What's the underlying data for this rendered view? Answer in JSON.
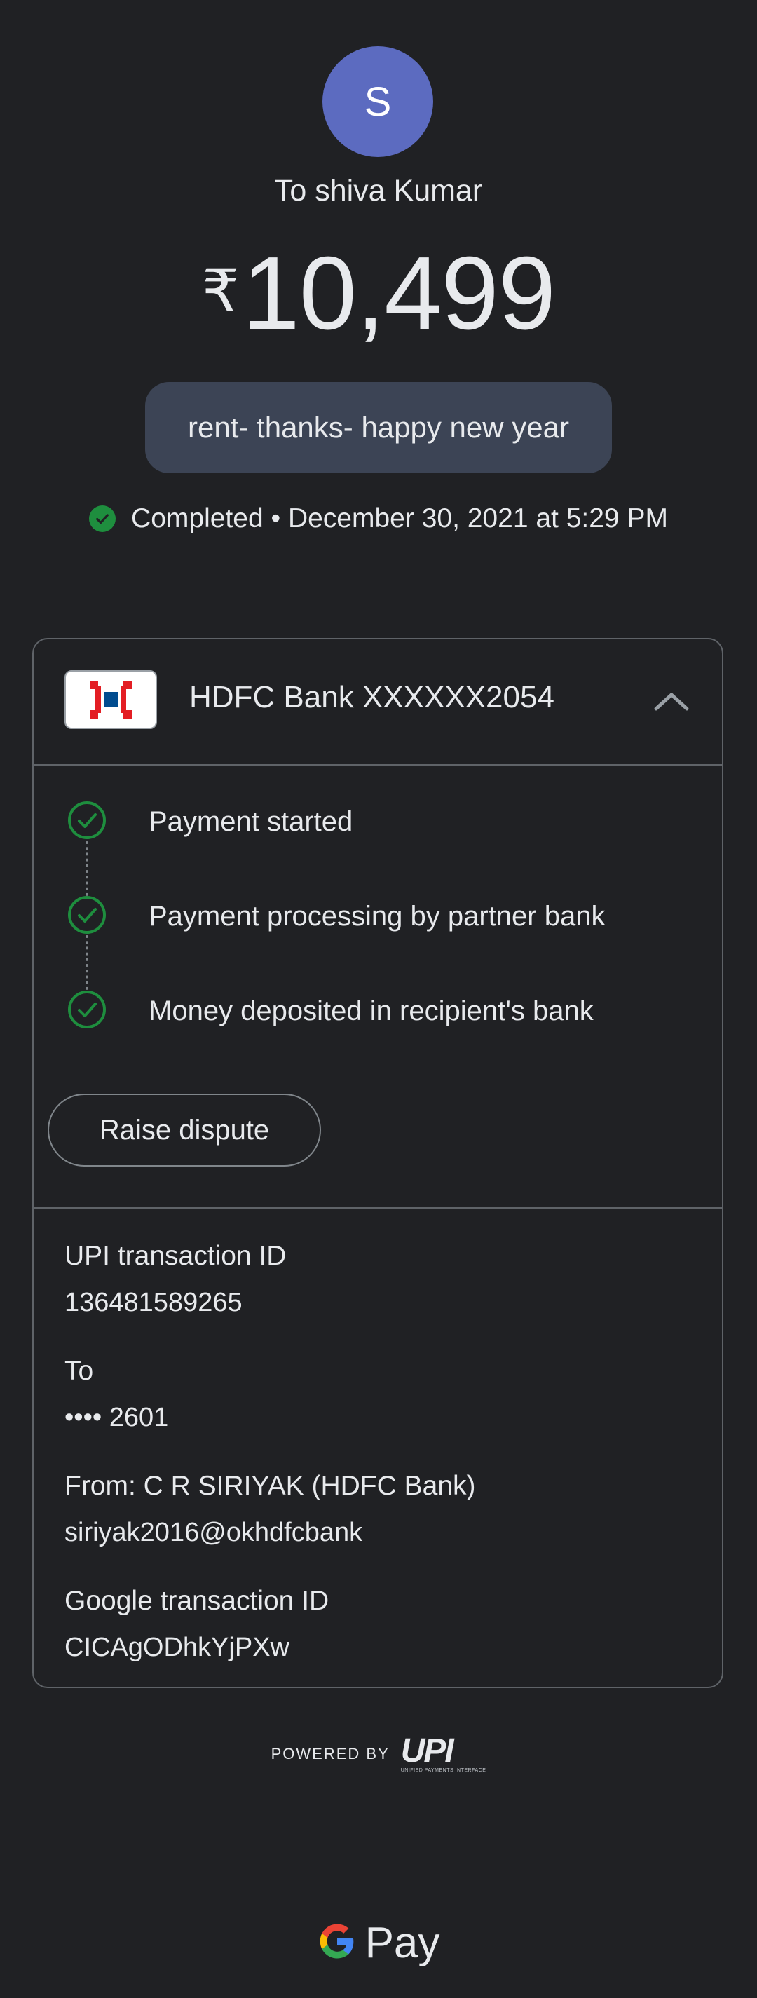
{
  "header": {
    "avatar_initial": "S",
    "recipient": "To shiva Kumar",
    "currency_symbol": "₹",
    "amount": "10,499",
    "note": "rent- thanks- happy new year",
    "status_text": "Completed • December 30, 2021 at 5:29 PM",
    "status_color": "#1e8e3e"
  },
  "bank": {
    "name": "HDFC Bank XXXXXX2054",
    "logo_icon": "hdfc-logo-icon",
    "expand_icon": "chevron-up-icon"
  },
  "timeline": [
    {
      "label": "Payment started"
    },
    {
      "label": "Payment processing by partner bank"
    },
    {
      "label": "Money deposited in recipient's bank"
    }
  ],
  "dispute_button": "Raise dispute",
  "details": {
    "upi_label": "UPI transaction ID",
    "upi_value": "136481589265",
    "to_label": "To",
    "to_value": "•••• 2601",
    "from_label": "From: C R SIRIYAK (HDFC Bank)",
    "from_value": "siriyak2016@okhdfcbank",
    "google_label": "Google transaction ID",
    "google_value": "CICAgODhkYjPXw"
  },
  "footer": {
    "powered_by": "POWERED BY",
    "upi_logo": "UPI",
    "upi_sub": "UNIFIED PAYMENTS INTERFACE",
    "gpay_text": "Pay"
  },
  "colors": {
    "background": "#202124",
    "note_bg": "#3c4455",
    "avatar": "#5c6bc0",
    "success": "#1e8e3e"
  }
}
